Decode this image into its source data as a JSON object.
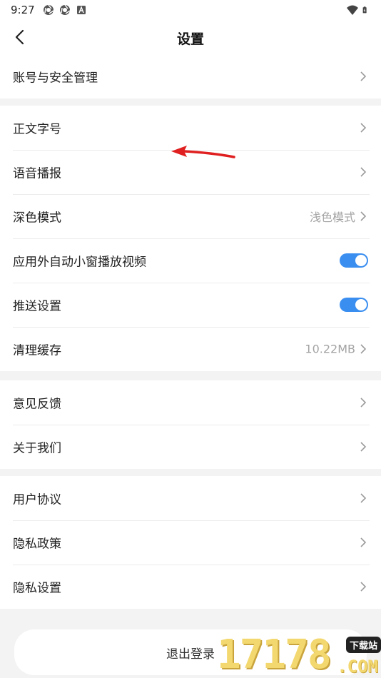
{
  "status_bar": {
    "time": "9:27"
  },
  "header": {
    "title": "设置"
  },
  "groups": [
    {
      "items": [
        {
          "label": "账号与安全管理"
        }
      ]
    },
    {
      "items": [
        {
          "label": "正文字号"
        },
        {
          "label": "语音播报"
        },
        {
          "label": "深色模式",
          "value": "浅色模式"
        },
        {
          "label": "应用外自动小窗播放视频",
          "toggle_on": true
        },
        {
          "label": "推送设置",
          "toggle_on": true
        },
        {
          "label": "清理缓存",
          "value": "10.22MB"
        }
      ]
    },
    {
      "items": [
        {
          "label": "意见反馈"
        },
        {
          "label": "关于我们"
        }
      ]
    },
    {
      "items": [
        {
          "label": "用户协议"
        },
        {
          "label": "隐私政策"
        },
        {
          "label": "隐私设置"
        }
      ]
    }
  ],
  "logout_label": "退出登录",
  "watermark": {
    "number": "17178",
    "tag": "下载站",
    "suffix": ".COM"
  },
  "colors": {
    "toggle_on": "#3a8ef0",
    "annotation_arrow": "#e02020",
    "background": "#f3f3f3"
  },
  "icons": [
    "chrome-icon",
    "chrome-icon",
    "text-icon",
    "wifi-icon",
    "battery-icon",
    "back-arrow-icon",
    "chevron-right-icon"
  ]
}
